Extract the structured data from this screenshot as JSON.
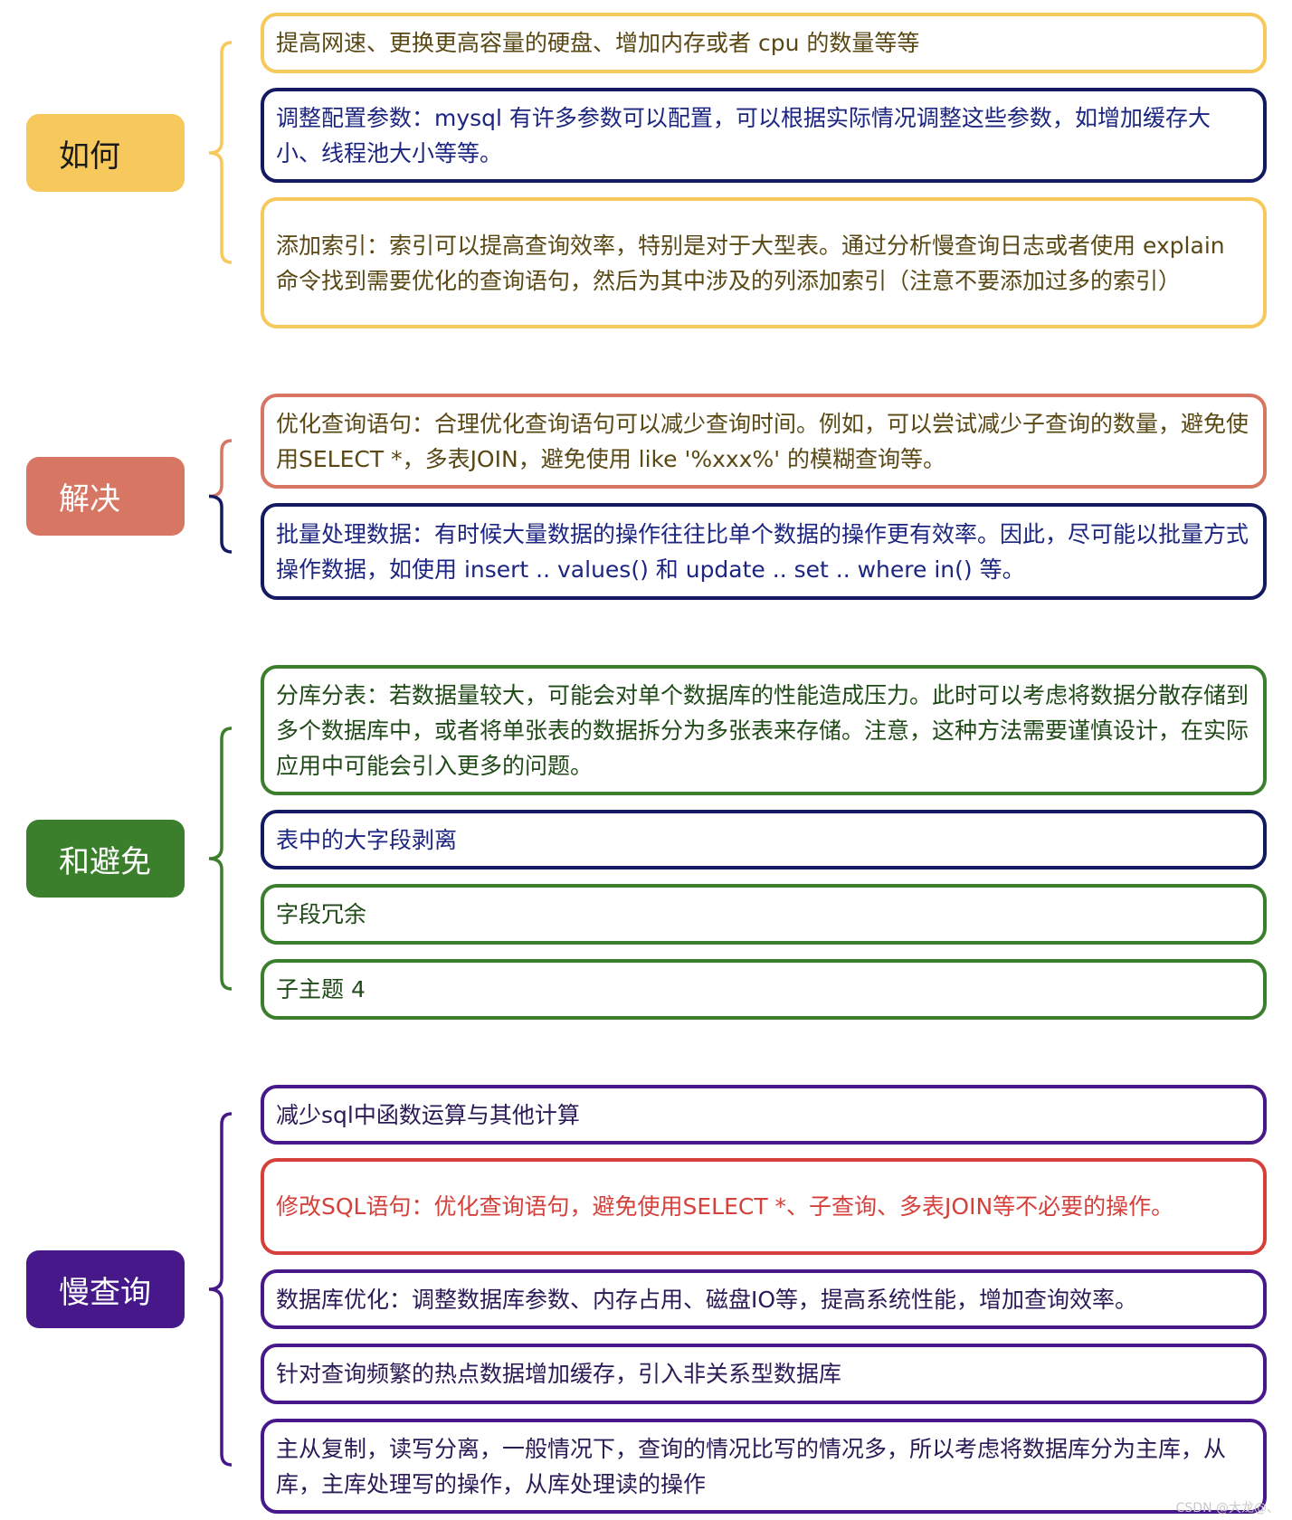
{
  "colors": {
    "yellow": "#f7c95c",
    "navy": "#131a62",
    "salmon": "#d67663",
    "green": "#3b7f2d",
    "purple": "#46188a",
    "red": "#d6403a"
  },
  "sections": [
    {
      "label": "如何",
      "color": "#f7c95c",
      "label_text_color": "#1a1a1a",
      "items": [
        {
          "text": "提高网速、更换更高容量的硬盘、增加内存或者 cpu 的数量等等",
          "border": "#f7c95c",
          "text_color": "#5a4814"
        },
        {
          "text": "调整配置参数：mysql 有许多参数可以配置，可以根据实际情况调整这些参数，如增加缓存大小、线程池大小等等。",
          "border": "#131a62",
          "text_color": "#1c2580"
        },
        {
          "text": "添加索引：索引可以提高查询效率，特别是对于大型表。通过分析慢查询日志或者使用 explain 命令找到需要优化的查询语句，然后为其中涉及的列添加索引（注意不要添加过多的索引）",
          "border": "#f7c95c",
          "text_color": "#5a4814"
        }
      ]
    },
    {
      "label": "解决",
      "color": "#d67663",
      "label_text_color": "#ffffff",
      "items": [
        {
          "text": "优化查询语句：合理优化查询语句可以减少查询时间。例如，可以尝试减少子查询的数量，避免使用SELECT *，多表JOIN，避免使用 like '%xxx%' 的模糊查询等。",
          "border": "#d67663",
          "text_color": "#5a4814"
        },
        {
          "text": "批量处理数据：有时候大量数据的操作往往比单个数据的操作更有效率。因此，尽可能以批量方式操作数据，如使用 insert .. values() 和 update .. set .. where in() 等。",
          "border": "#131a62",
          "text_color": "#1c2580"
        }
      ]
    },
    {
      "label": "和避免",
      "color": "#3b7f2d",
      "label_text_color": "#ffffff",
      "items": [
        {
          "text": "分库分表：若数据量较大，可能会对单个数据库的性能造成压力。此时可以考虑将数据分散存储到多个数据库中，或者将单张表的数据拆分为多张表来存储。注意，这种方法需要谨慎设计，在实际应用中可能会引入更多的问题。",
          "border": "#3b7f2d",
          "text_color": "#1f4a17"
        },
        {
          "text": "表中的大字段剥离",
          "border": "#131a62",
          "text_color": "#1c2580"
        },
        {
          "text": "字段冗余",
          "border": "#3b7f2d",
          "text_color": "#1f4a17"
        },
        {
          "text": "子主题 4",
          "border": "#3b7f2d",
          "text_color": "#1f4a17"
        }
      ]
    },
    {
      "label": "慢查询",
      "color": "#46188a",
      "label_text_color": "#ffffff",
      "items": [
        {
          "text": "减少sql中函数运算与其他计算",
          "border": "#46188a",
          "text_color": "#2a1a55"
        },
        {
          "text": "修改SQL语句：优化查询语句，避免使用SELECT *、子查询、多表JOIN等不必要的操作。",
          "border": "#d6403a",
          "text_color": "#d6403a"
        },
        {
          "text": "数据库优化：调整数据库参数、内存占用、磁盘IO等，提高系统性能，增加查询效率。",
          "border": "#46188a",
          "text_color": "#2a1a55"
        },
        {
          "text": "针对查询频繁的热点数据增加缓存，引入非关系型数据库",
          "border": "#46188a",
          "text_color": "#2a1a55"
        },
        {
          "text": "主从复制，读写分离，一般情况下，查询的情况比写的情况多，所以考虑将数据库分为主库，从库，主库处理写的操作，从库处理读的操作",
          "border": "#46188a",
          "text_color": "#2a1a55"
        }
      ]
    }
  ],
  "watermark": "CSDN @大龙@、"
}
